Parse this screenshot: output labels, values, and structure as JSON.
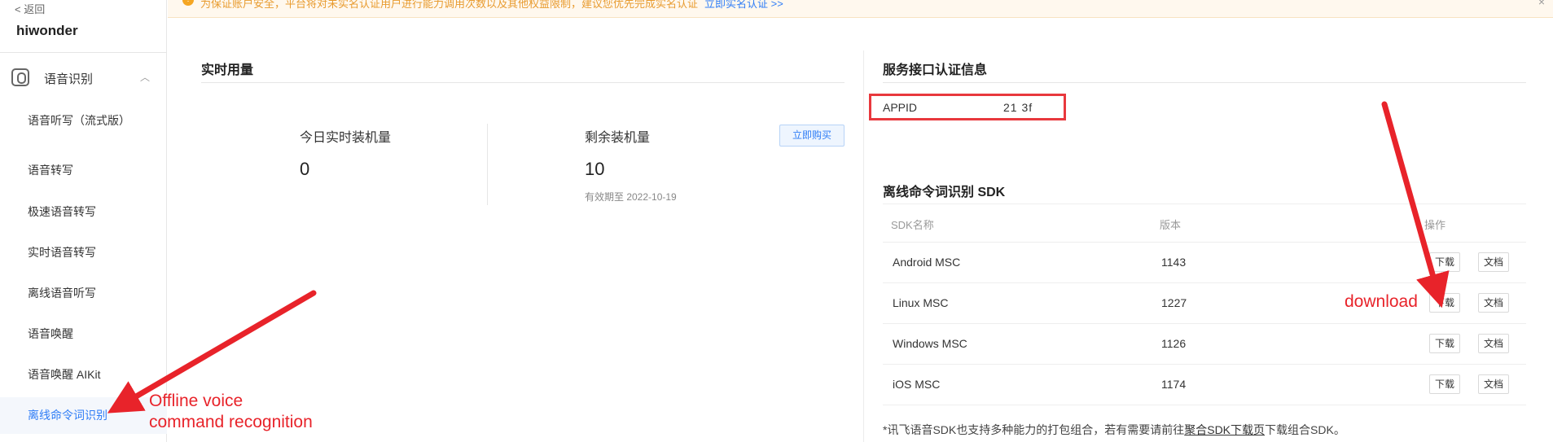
{
  "sidebar": {
    "back_label": "< 返回",
    "app_name": "hiwonder",
    "group_title": "语音识别",
    "items": [
      {
        "label": "语音听写（流式版）"
      },
      {
        "label": "语音转写"
      },
      {
        "label": "极速语音转写"
      },
      {
        "label": "实时语音转写"
      },
      {
        "label": "离线语音听写"
      },
      {
        "label": "语音唤醒"
      },
      {
        "label": "语音唤醒 AIKit"
      },
      {
        "label": "离线命令词识别"
      }
    ],
    "active_item": "离线命令词识别"
  },
  "banner": {
    "text": "为保证账户安全，平台将对未实名认证用户进行能力调用次数以及其他权益限制，建议您优先完成实名认证",
    "link": "立即实名认证 >>",
    "close": "×"
  },
  "usage": {
    "title": "实时用量",
    "today_label": "今日实时装机量",
    "today_value": "0",
    "remaining_label": "剩余装机量",
    "remaining_value": "10",
    "expiry": "有效期至 2022-10-19",
    "buy_button": "立即购买"
  },
  "auth": {
    "title": "服务接口认证信息",
    "appid_label": "APPID",
    "appid_value": "21      3f"
  },
  "sdk": {
    "title": "离线命令词识别 SDK",
    "columns": [
      "SDK名称",
      "版本",
      "操作"
    ],
    "rows": [
      {
        "name": "Android MSC",
        "version": "1143",
        "download": "下载",
        "docs": "文档"
      },
      {
        "name": "Linux MSC",
        "version": "1227",
        "download": "下载",
        "docs": "文档"
      },
      {
        "name": "Windows MSC",
        "version": "1126",
        "download": "下载",
        "docs": "文档"
      },
      {
        "name": "iOS MSC",
        "version": "1174",
        "download": "下载",
        "docs": "文档"
      }
    ],
    "note_prefix": "*讯飞语音SDK也支持多种能力的打包组合，若有需要请前往",
    "note_link": "聚合SDK下载页",
    "note_suffix": "下载组合SDK。"
  },
  "annotations": {
    "download_label": "download",
    "offline_label_line1": "Offline voice",
    "offline_label_line2": "command recognition",
    "color": "#e8232a"
  }
}
